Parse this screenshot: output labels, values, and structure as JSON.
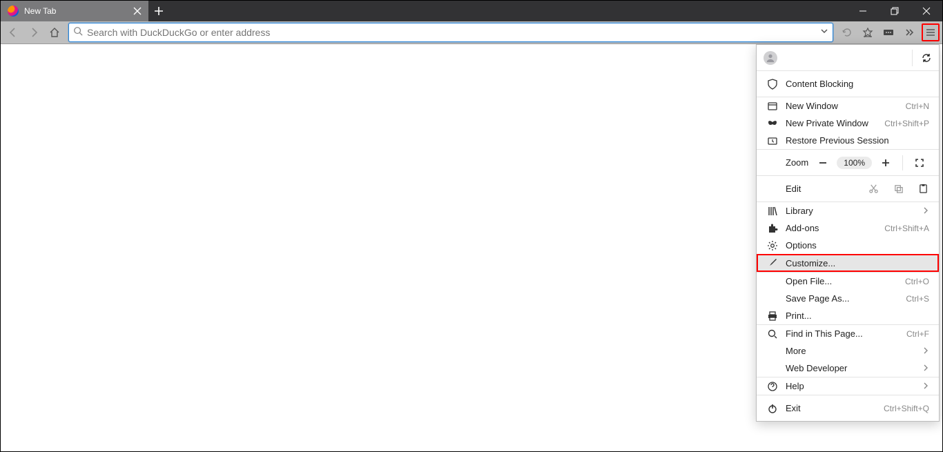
{
  "tab": {
    "title": "New Tab"
  },
  "urlbar": {
    "placeholder": "Search with DuckDuckGo or enter address"
  },
  "menu": {
    "content_blocking": "Content Blocking",
    "new_window": {
      "label": "New Window",
      "shortcut": "Ctrl+N"
    },
    "new_private": {
      "label": "New Private Window",
      "shortcut": "Ctrl+Shift+P"
    },
    "restore": "Restore Previous Session",
    "zoom": {
      "label": "Zoom",
      "value": "100%"
    },
    "edit": "Edit",
    "library": "Library",
    "addons": {
      "label": "Add-ons",
      "shortcut": "Ctrl+Shift+A"
    },
    "options": "Options",
    "customize": "Customize...",
    "open_file": {
      "label": "Open File...",
      "shortcut": "Ctrl+O"
    },
    "save_page": {
      "label": "Save Page As...",
      "shortcut": "Ctrl+S"
    },
    "print": "Print...",
    "find": {
      "label": "Find in This Page...",
      "shortcut": "Ctrl+F"
    },
    "more": "More",
    "webdev": "Web Developer",
    "help": "Help",
    "exit": {
      "label": "Exit",
      "shortcut": "Ctrl+Shift+Q"
    }
  }
}
